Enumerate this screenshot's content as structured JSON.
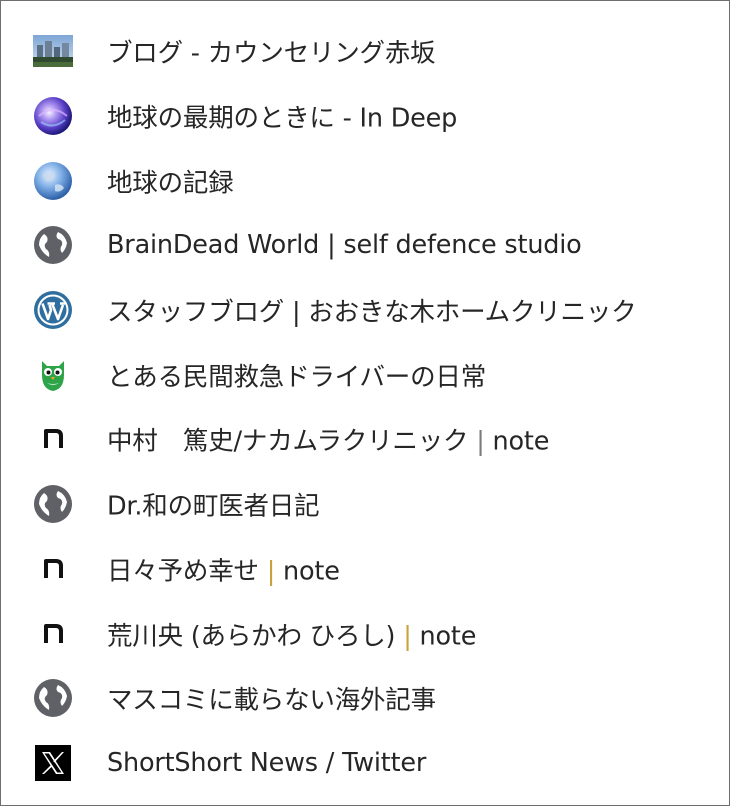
{
  "bookmarks": [
    {
      "title": "ブログ - カウンセリング赤坂",
      "icon": "photo-favicon-icon"
    },
    {
      "title": "地球の最期のときに - In Deep",
      "icon": "purple-orb-icon"
    },
    {
      "title": "地球の記録",
      "icon": "earth-globe-icon"
    },
    {
      "title": "BrainDead World | self defence studio",
      "icon": "default-globe-icon"
    },
    {
      "title": "スタッフブログ | おおきな木ホームクリニック",
      "icon": "wordpress-icon"
    },
    {
      "title": "とある民間救急ドライバーの日常",
      "icon": "green-owl-icon"
    },
    {
      "title_main": "中村　篤史/ナカムラクリニック",
      "title_sep": "|",
      "title_tail": "note",
      "icon": "note-icon"
    },
    {
      "title": "Dr.和の町医者日記",
      "icon": "default-globe-icon"
    },
    {
      "title_main": "日々予め幸せ",
      "title_sep": "|",
      "title_tail": "note",
      "icon": "note-icon"
    },
    {
      "title_main": "荒川央 (あらかわ ひろし)",
      "title_sep": "|",
      "title_tail": "note",
      "icon": "note-icon"
    },
    {
      "title": "マスコミに載らない海外記事",
      "icon": "default-globe-icon"
    },
    {
      "title": "ShortShort News / Twitter",
      "icon": "x-logo-icon"
    }
  ]
}
